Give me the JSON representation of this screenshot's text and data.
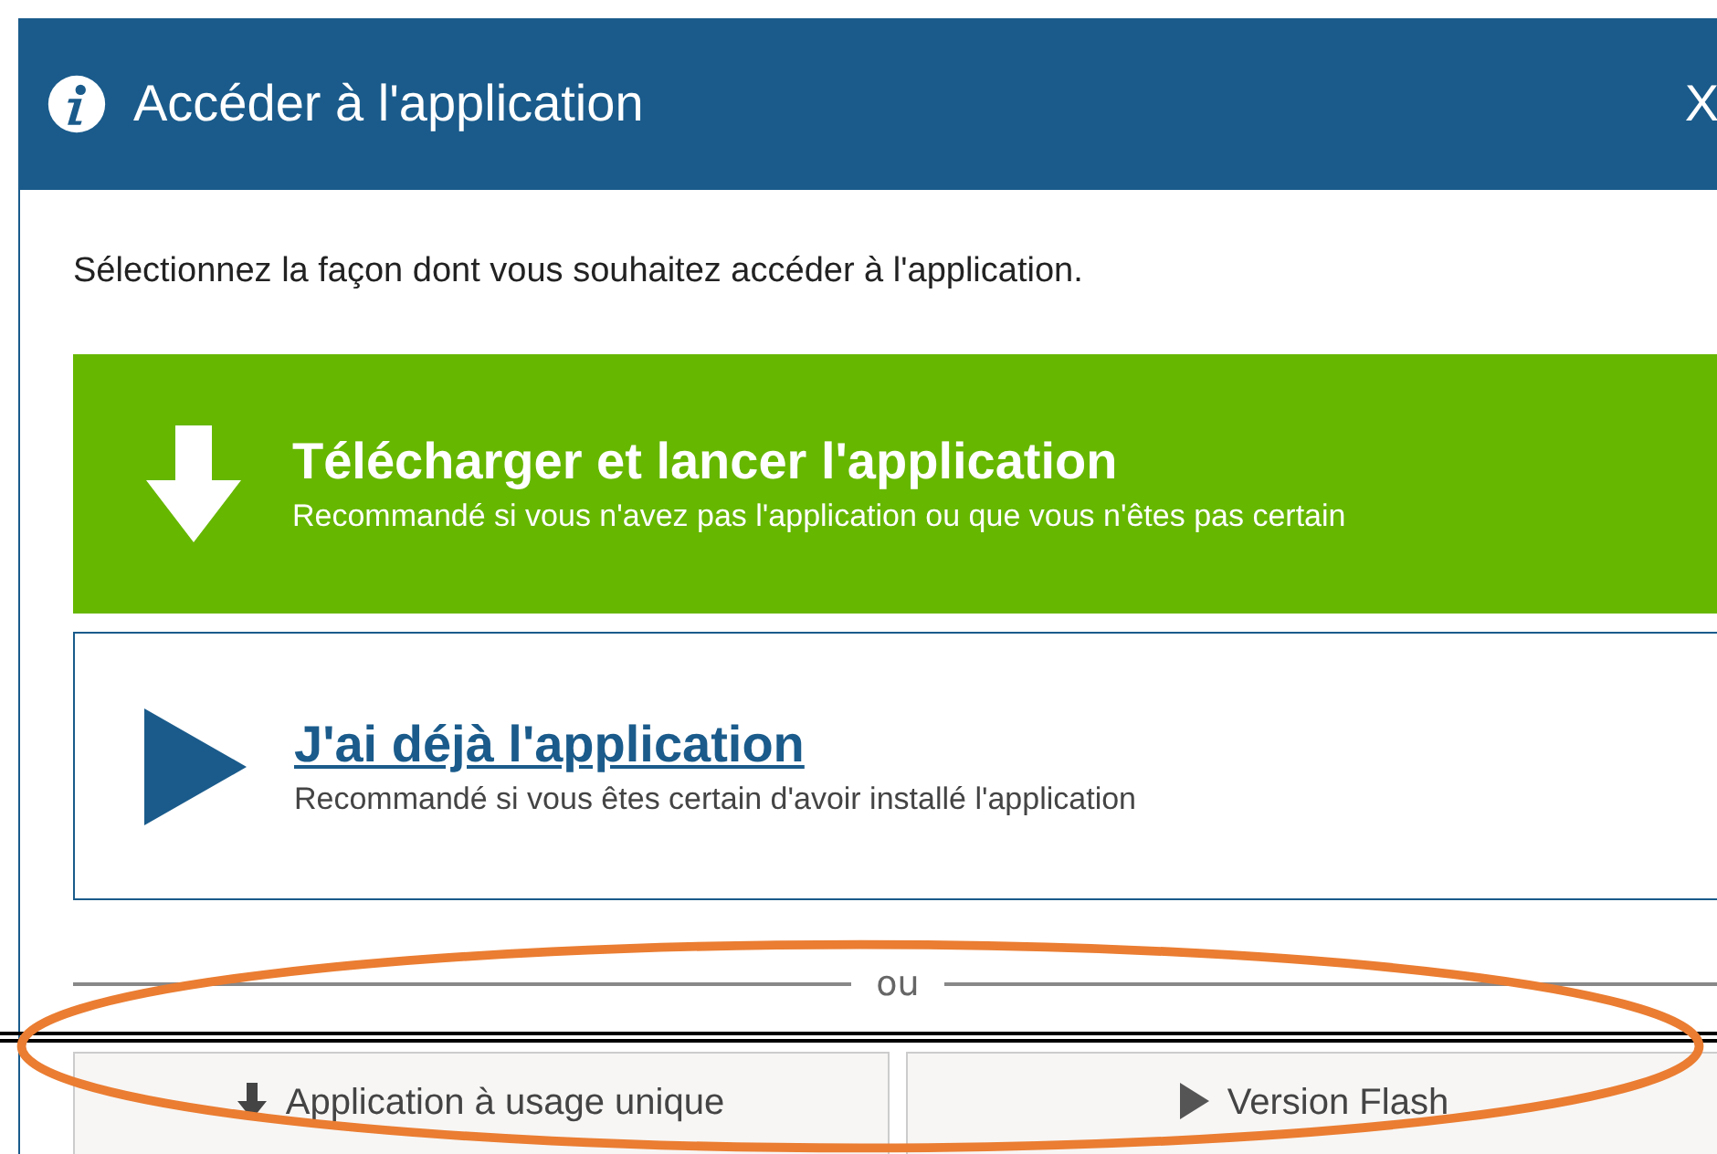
{
  "window": {
    "title": "Accéder à l'application",
    "close": "X"
  },
  "instruction": "Sélectionnez la façon dont vous souhaitez accéder à l'application.",
  "options": [
    {
      "kind": "download",
      "title": "Télécharger et lancer l'application",
      "subtitle": "Recommandé si vous n'avez pas l'application ou que vous n'êtes pas certain"
    },
    {
      "kind": "launch",
      "title": "J'ai déjà l'application",
      "subtitle": "Recommandé si vous êtes certain d'avoir installé l'application"
    }
  ],
  "separator": "ou",
  "alternatives": [
    {
      "kind": "download",
      "label": "Application à usage unique"
    },
    {
      "kind": "play",
      "label": "Version Flash"
    }
  ]
}
